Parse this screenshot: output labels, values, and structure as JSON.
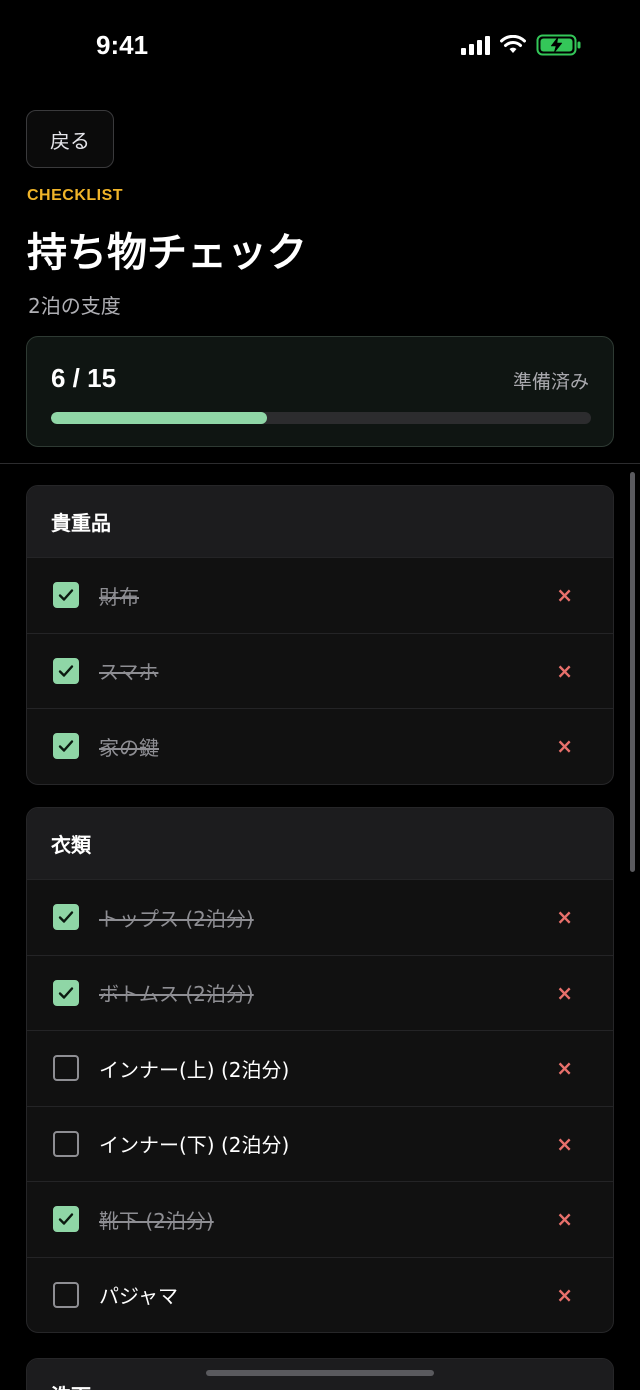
{
  "status_bar": {
    "time": "9:41",
    "signal_icon": "signal-icon",
    "wifi_icon": "wifi-icon",
    "battery_icon": "battery-charging-icon",
    "battery_color": "#34c759"
  },
  "header": {
    "back_label": "戻る",
    "eyebrow": "CHECKLIST",
    "title": "持ち物チェック",
    "subtitle": "2泊の支度"
  },
  "progress": {
    "count_text": "6 / 15",
    "label": "準備済み",
    "fraction": 0.4,
    "accent_color": "#8fd6a6"
  },
  "sections": [
    {
      "title": "貴重品",
      "items": [
        {
          "label": "財布",
          "checked": true
        },
        {
          "label": "スマホ",
          "checked": true
        },
        {
          "label": "家の鍵",
          "checked": true
        }
      ]
    },
    {
      "title": "衣類",
      "items": [
        {
          "label": "トップス (2泊分)",
          "checked": true
        },
        {
          "label": "ボトムス (2泊分)",
          "checked": true
        },
        {
          "label": "インナー(上) (2泊分)",
          "checked": false
        },
        {
          "label": "インナー(下) (2泊分)",
          "checked": false
        },
        {
          "label": "靴下 (2泊分)",
          "checked": true
        },
        {
          "label": "パジャマ",
          "checked": false
        }
      ]
    },
    {
      "title": "洗面",
      "items": []
    }
  ],
  "delete_symbol": "×",
  "delete_color": "#e8706b"
}
